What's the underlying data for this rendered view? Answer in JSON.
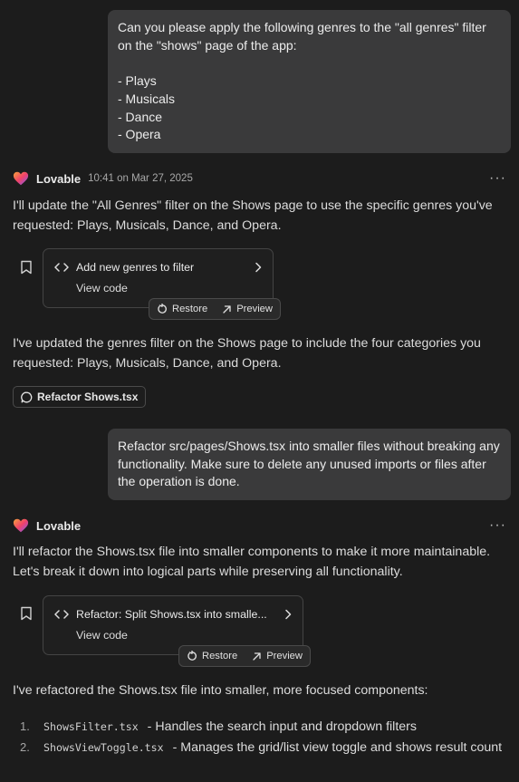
{
  "messages": {
    "user1": "Can you please apply the following genres to the \"all genres\" filter on the \"shows\" page of the app:\n\n- Plays\n- Musicals\n- Dance\n- Opera",
    "assistant1": {
      "name": "Lovable",
      "time": "10:41 on Mar 27, 2025",
      "intro": "I'll update the \"All Genres\" filter on the Shows page to use the specific genres you've requested: Plays, Musicals, Dance, and Opera.",
      "card_title": "Add new genres to filter",
      "view_code": "View code",
      "restore": "Restore",
      "preview": "Preview",
      "outro": "I've updated the genres filter on the Shows page to include the four categories you requested: Plays, Musicals, Dance, and Opera.",
      "chip": "Refactor Shows.tsx"
    },
    "user2": "Refactor src/pages/Shows.tsx into smaller files without breaking any functionality. Make sure to delete any unused imports or files after the operation is done.",
    "assistant2": {
      "name": "Lovable",
      "intro": "I'll refactor the Shows.tsx file into smaller components to make it more maintainable. Let's break it down into logical parts while preserving all functionality.",
      "card_title": "Refactor: Split Shows.tsx into smalle...",
      "view_code": "View code",
      "restore": "Restore",
      "preview": "Preview",
      "outro": "I've refactored the Shows.tsx file into smaller, more focused components:",
      "list": [
        {
          "num": "1.",
          "file": "ShowsFilter.tsx",
          "desc": "- Handles the search input and dropdown filters"
        },
        {
          "num": "2.",
          "file": "ShowsViewToggle.tsx",
          "desc": "- Manages the grid/list view toggle and shows result count"
        }
      ]
    }
  },
  "icons": {
    "more": "more-horizontal-icon",
    "brand": "lovable-heart-icon",
    "bookmark": "bookmark-icon",
    "code": "code-brackets-icon",
    "chevron": "chevron-right-icon",
    "restore": "restore-icon",
    "preview": "arrow-up-right-icon",
    "chip": "chat-bubble-icon"
  },
  "colors": {
    "background": "#1c1c1c",
    "user_bubble": "#3a3a3b",
    "heart_gradient": [
      "#f0426a",
      "#f7a23c",
      "#7a5cf5"
    ]
  }
}
